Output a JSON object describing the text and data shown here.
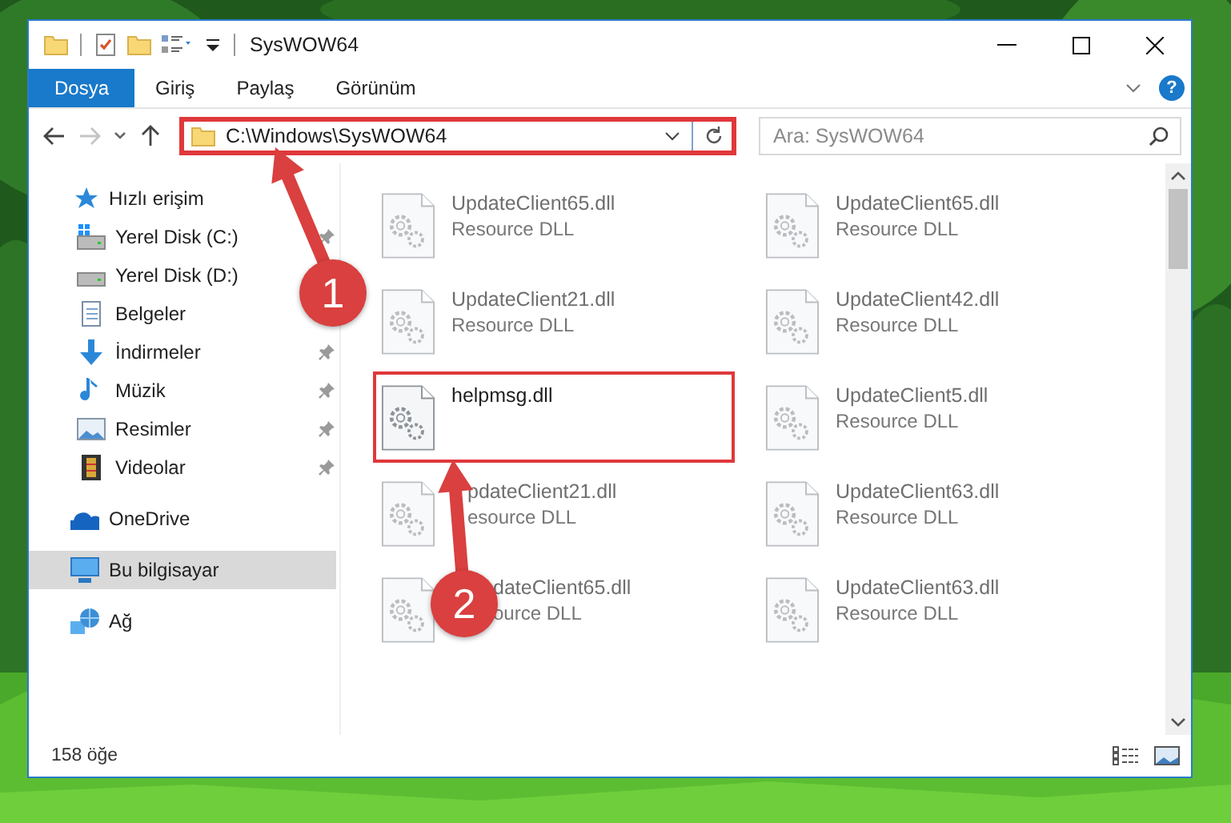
{
  "window": {
    "title": "SysWOW64"
  },
  "ribbon_tabs": [
    {
      "label": "Dosya",
      "selected": true
    },
    {
      "label": "Giriş",
      "selected": false
    },
    {
      "label": "Paylaş",
      "selected": false
    },
    {
      "label": "Görünüm",
      "selected": false
    }
  ],
  "help_button": "?",
  "navigation": {
    "forward_disabled": true
  },
  "address_bar": {
    "value": "C:\\Windows\\SysWOW64",
    "highlighted": true
  },
  "search": {
    "placeholder": "Ara: SysWOW64"
  },
  "sidebar": {
    "items": [
      {
        "label": "Hızlı erişim",
        "kind": "star",
        "selected": false,
        "children": [
          {
            "label": "Yerel Disk (C:)",
            "kind": "system-drive",
            "pinned": true,
            "selected": false
          },
          {
            "label": "Yerel Disk (D:)",
            "kind": "drive",
            "selected": false
          },
          {
            "label": "Belgeler",
            "kind": "documents",
            "selected": false
          },
          {
            "label": "İndirmeler",
            "kind": "downloads",
            "pinned": true,
            "selected": false
          },
          {
            "label": "Müzik",
            "kind": "music",
            "pinned": true,
            "selected": false
          },
          {
            "label": "Resimler",
            "kind": "pictures",
            "pinned": true,
            "selected": false
          },
          {
            "label": "Videolar",
            "kind": "videos",
            "pinned": true,
            "selected": false
          }
        ]
      },
      {
        "label": "OneDrive",
        "kind": "cloud",
        "selected": false
      },
      {
        "label": "Bu bilgisayar",
        "kind": "computer",
        "selected": true
      },
      {
        "label": "Ağ",
        "kind": "network",
        "selected": false
      }
    ]
  },
  "files": [
    {
      "name": "UpdateClient65.dll",
      "type": "Resource DLL",
      "blurred": true,
      "highlighted": false,
      "partly_covered": false
    },
    {
      "name": "UpdateClient65.dll",
      "type": "Resource DLL",
      "blurred": true,
      "highlighted": false,
      "partly_covered": false
    },
    {
      "name": "UpdateClient21.dll",
      "type": "Resource DLL",
      "blurred": true,
      "highlighted": false,
      "partly_covered": false
    },
    {
      "name": "UpdateClient42.dll",
      "type": "Resource DLL",
      "blurred": true,
      "highlighted": false,
      "partly_covered": false
    },
    {
      "name": "helpmsg.dll",
      "blurred": false,
      "highlighted": true,
      "partly_covered": false
    },
    {
      "name": "UpdateClient5.dll",
      "type": "Resource DLL",
      "blurred": true,
      "highlighted": false,
      "partly_covered": false
    },
    {
      "name": "pdateClient21.dll",
      "type": "esource DLL",
      "blurred": true,
      "highlighted": false,
      "partly_covered": true
    },
    {
      "name": "UpdateClient63.dll",
      "type": "Resource DLL",
      "blurred": true,
      "highlighted": false,
      "partly_covered": false
    },
    {
      "name": "dateClient65.dll",
      "type": "ource DLL",
      "blurred": true,
      "highlighted": false,
      "partly_covered": true
    },
    {
      "name": "UpdateClient63.dll",
      "type": "Resource DLL",
      "blurred": true,
      "highlighted": false,
      "partly_covered": false
    }
  ],
  "status_bar": {
    "item_count": "158 öğe"
  },
  "callouts": [
    {
      "number": "1"
    },
    {
      "number": "2"
    }
  ]
}
